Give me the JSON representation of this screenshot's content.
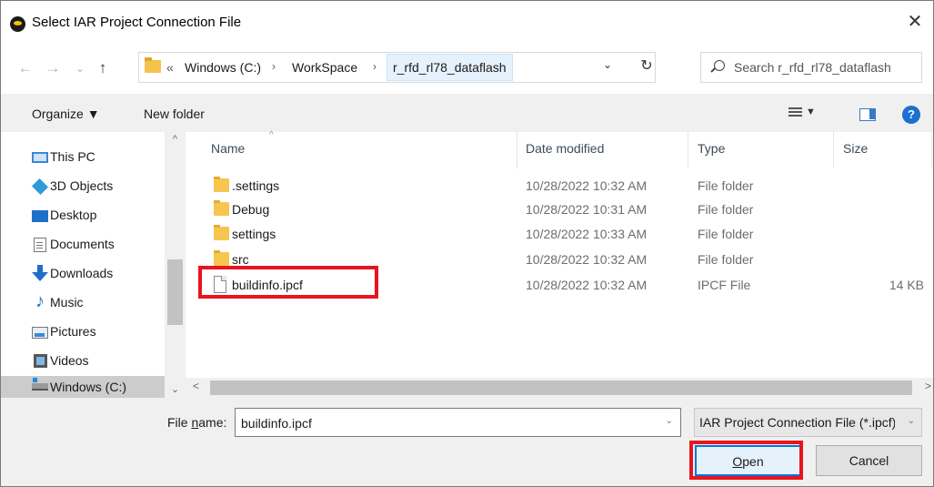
{
  "window": {
    "title": "Select IAR Project Connection File",
    "close_glyph": "✕"
  },
  "navigation": {
    "back_glyph": "←",
    "forward_glyph": "→",
    "recent_glyph": "⌄",
    "up_glyph": "↑"
  },
  "address": {
    "overflow": "«",
    "crumbs": [
      "Windows (C:)",
      "WorkSpace",
      "r_rfd_rl78_dataflash"
    ],
    "separator": "›"
  },
  "search": {
    "placeholder": "Search r_rfd_rl78_dataflash"
  },
  "toolbar": {
    "organize": "Organize ▼",
    "new_folder": "New folder",
    "help": "?"
  },
  "sidebar": {
    "items": [
      {
        "label": "This PC",
        "icon": "computer-icon"
      },
      {
        "label": "3D Objects",
        "icon": "cube-icon"
      },
      {
        "label": "Desktop",
        "icon": "desktop-icon"
      },
      {
        "label": "Documents",
        "icon": "document-icon"
      },
      {
        "label": "Downloads",
        "icon": "download-icon"
      },
      {
        "label": "Music",
        "icon": "music-icon"
      },
      {
        "label": "Pictures",
        "icon": "picture-icon"
      },
      {
        "label": "Videos",
        "icon": "video-icon"
      },
      {
        "label": "Windows (C:)",
        "icon": "drive-icon",
        "selected": true
      }
    ]
  },
  "filelist": {
    "columns": [
      "Name",
      "Date modified",
      "Type",
      "Size"
    ],
    "rows": [
      {
        "name": ".settings",
        "date": "10/28/2022 10:32 AM",
        "type": "File folder",
        "size": "",
        "kind": "folder"
      },
      {
        "name": "Debug",
        "date": "10/28/2022 10:31 AM",
        "type": "File folder",
        "size": "",
        "kind": "folder"
      },
      {
        "name": "settings",
        "date": "10/28/2022 10:33 AM",
        "type": "File folder",
        "size": "",
        "kind": "folder"
      },
      {
        "name": "src",
        "date": "10/28/2022 10:32 AM",
        "type": "File folder",
        "size": "",
        "kind": "folder"
      },
      {
        "name": "buildinfo.ipcf",
        "date": "10/28/2022 10:32 AM",
        "type": "IPCF File",
        "size": "14 KB",
        "kind": "file"
      }
    ]
  },
  "footer": {
    "file_name_label_pre": "File ",
    "file_name_label_key": "n",
    "file_name_label_post": "ame:",
    "file_name_value": "buildinfo.ipcf",
    "file_type": "IAR Project Connection File (*.ipcf)",
    "open_key": "O",
    "open_rest": "pen",
    "cancel": "Cancel"
  },
  "colors": {
    "highlight": "#e8141e",
    "accent": "#0078d7",
    "folder": "#f6c651"
  }
}
